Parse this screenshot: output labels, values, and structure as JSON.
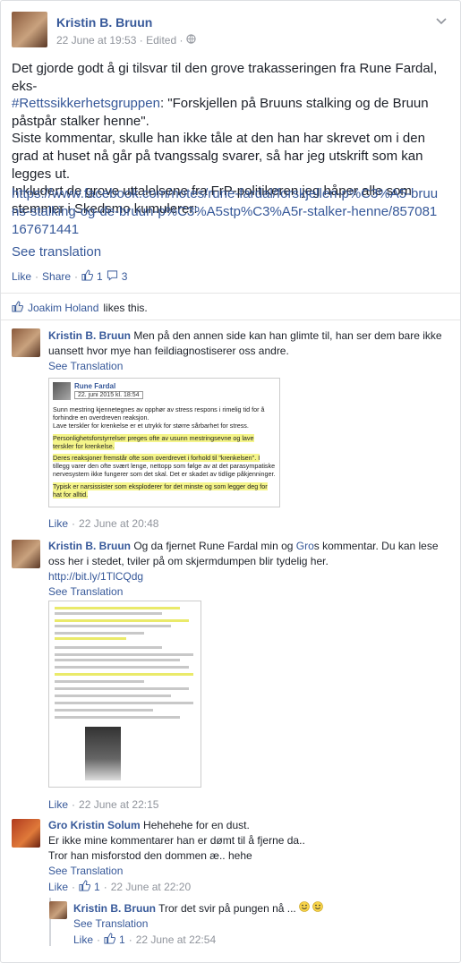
{
  "post": {
    "author": "Kristin B. Bruun",
    "date": "22 June at 19:53",
    "edited": "Edited",
    "body": [
      "Det gjorde godt å gi tilsvar til den grove trakasseringen fra Rune Fardal, eks-",
      "#Rettssikkerhetsgruppen",
      ": \"Forskjellen på Bruuns stalking og de Bruun påstpår stalker henne\".",
      "Siste kommentar, skulle han ikke tåle at den han har skrevet om i den grad at huset nå går på tvangssalg svarer, så har jeg utskrift som kan legges ut.",
      "Inkludert de grove uttalelsene fra FrP-politikeren jeg håper alle som stemmer i Skedsmo kumulerer:"
    ],
    "url": "https://www.facebook.com/notes/rune-fardal/forskjellen-p%C3%A5-bruuns-stalking-og-de-bruun-p%C3%A5stp%C3%A5r-stalker-henne/857081167671441",
    "see_translation": "See translation",
    "actions": {
      "like": "Like",
      "share": "Share",
      "like_count": "1",
      "comment_count": "3"
    },
    "liked_by": "Joakim Holand",
    "likes_this": "likes this."
  },
  "comments": [
    {
      "author": "Kristin B. Bruun",
      "text": "Men på den annen side kan han glimte til, han ser dem bare ikke uansett hvor mye han feildiagnostiserer oss andre.",
      "see_translation": "See Translation",
      "like": "Like",
      "time": "22 June at 20:48",
      "shot": {
        "name": "Rune Fardal",
        "date": "22. juni 2015 kl. 18:54",
        "lines": [
          "Sunn mestring kjennetegnes av opphør av stress respons i rimelig tid for å",
          "forhindre en overdreven reaksjon.",
          "Lave terskler for krenkelse er et utrykk for større sårbarhet for stress.",
          "Personlighetsforstyrrelser preges ofte av usunn mestringsevne og lave",
          "terskler for krenkelse.",
          "Deres reaksjoner fremstår ofte som overdrevet i forhold til \"krenkelsen\". I",
          "tillegg varer den ofte svært lenge, nettopp som følge av at det parasympatiske",
          "nervesystem ikke fungerer som det skal. Det er skadet av tidlige påkjenninger.",
          "Typisk er narsissister som eksploderer for det minste og som legger deg for",
          "hat for alltid."
        ]
      }
    },
    {
      "author": "Kristin B. Bruun",
      "text_a": "Og da fjernet Rune Fardal min og ",
      "mention": "Gro",
      "text_b": "s kommentar. Du kan lese oss her i stedet, tviler på om skjermdumpen blir tydelig her.",
      "link": "http://bit.ly/1TlCQdg",
      "see_translation": "See Translation",
      "like": "Like",
      "time": "22 June at 22:15"
    },
    {
      "author": "Gro Kristin Solum",
      "text": "Hehehehe for en dust.",
      "line2": "Er ikke mine kommentarer han er dømt til å fjerne da..",
      "line3": "Tror han misforstod den dommen æ.. hehe",
      "see_translation": "See Translation",
      "like": "Like",
      "like_count": "1",
      "time": "22 June at 22:20"
    },
    {
      "author": "Kristin B. Bruun",
      "text": "Tror det svir på pungen nå ...",
      "see_translation": "See Translation",
      "like": "Like",
      "like_count": "1",
      "time": "22 June at 22:54"
    }
  ],
  "colors": {
    "link": "#365899",
    "meta": "#90949c",
    "highlight": "#f5f58a"
  }
}
